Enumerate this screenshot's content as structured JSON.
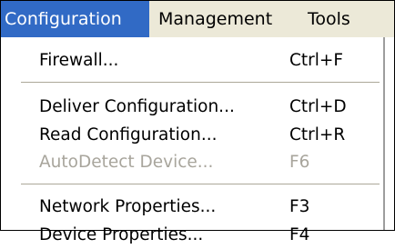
{
  "menubar": {
    "items": [
      {
        "label": "Configuration"
      },
      {
        "label": "Management"
      },
      {
        "label": "Tools"
      }
    ]
  },
  "menu": {
    "items": [
      {
        "label": "Firewall...",
        "shortcut": "Ctrl+F",
        "enabled": true
      },
      {
        "label": "Deliver Configuration...",
        "shortcut": "Ctrl+D",
        "enabled": true
      },
      {
        "label": "Read Configuration...",
        "shortcut": "Ctrl+R",
        "enabled": true
      },
      {
        "label": "AutoDetect Device...",
        "shortcut": "F6",
        "enabled": false
      },
      {
        "label": "Network Properties...",
        "shortcut": "F3",
        "enabled": true
      },
      {
        "label": "Device Properties...",
        "shortcut": "F4",
        "enabled": true
      }
    ]
  },
  "colors": {
    "highlight": "#316ac5",
    "menubar_bg": "#ece9d8",
    "disabled_text": "#a8a59c"
  }
}
